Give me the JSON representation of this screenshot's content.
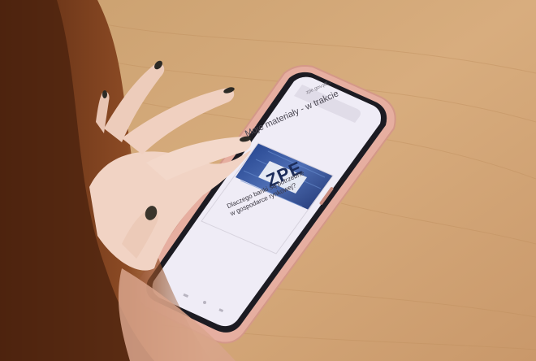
{
  "scene": {
    "description_free": true
  },
  "phone_screen": {
    "url_bar": "zpe.gov.pl/...",
    "heading": "Moje materiały - w trakcie",
    "card": {
      "logo": "ZPE",
      "date": "",
      "title_line1": "Dlaczego banki są potrzebne",
      "title_line2": "w gospodarce rynkowej?",
      "meta": ""
    }
  },
  "colors": {
    "table": "#d9ad7c",
    "phone_case": "#e8b3a6",
    "screen": "#efecf6",
    "nails": "#2c2a25",
    "hair": "#7a3f1e"
  }
}
